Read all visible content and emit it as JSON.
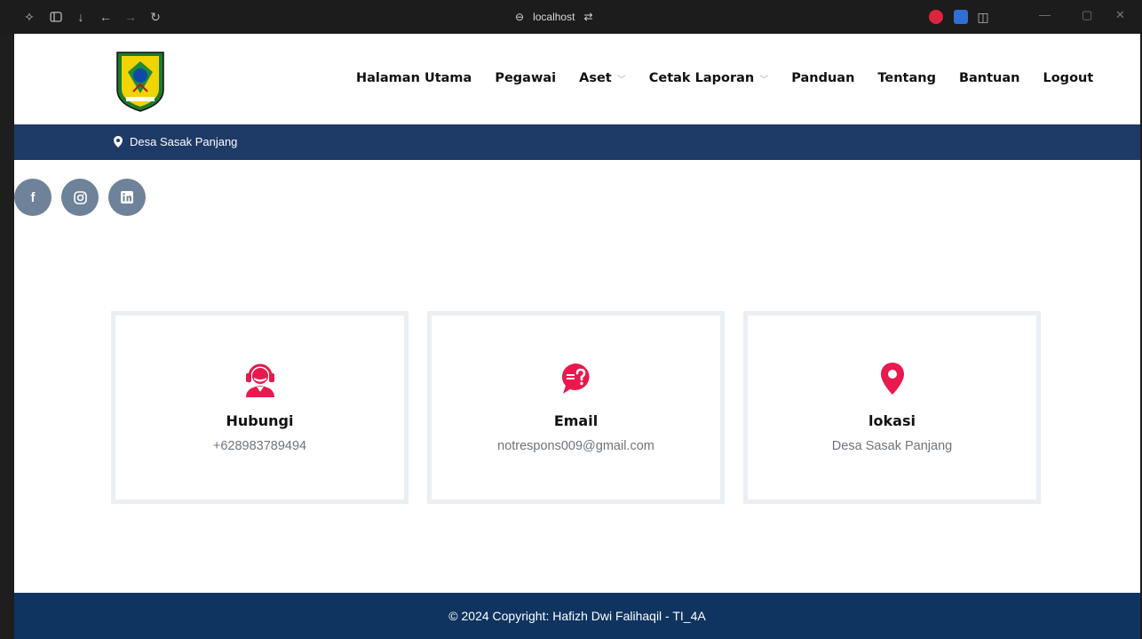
{
  "browser": {
    "url": "localhost"
  },
  "nav": {
    "items": [
      {
        "label": "Halaman Utama",
        "dropdown": false
      },
      {
        "label": "Pegawai",
        "dropdown": false
      },
      {
        "label": "Aset",
        "dropdown": true
      },
      {
        "label": "Cetak Laporan",
        "dropdown": true
      },
      {
        "label": "Panduan",
        "dropdown": false
      },
      {
        "label": "Tentang",
        "dropdown": false
      },
      {
        "label": "Bantuan",
        "dropdown": false
      },
      {
        "label": "Logout",
        "dropdown": false
      }
    ]
  },
  "topbar": {
    "location": "Desa Sasak Panjang"
  },
  "social": [
    "facebook-icon",
    "instagram-icon",
    "linkedin-icon"
  ],
  "cards": [
    {
      "icon": "customer-service-icon",
      "title": "Hubungi",
      "value": "+628983789494"
    },
    {
      "icon": "chat-question-icon",
      "title": "Email",
      "value": "notrespons009@gmail.com"
    },
    {
      "icon": "location-pin-icon",
      "title": "lokasi",
      "value": "Desa Sasak Panjang"
    }
  ],
  "footer": {
    "copyright": "© 2024 Copyright: Hafizh Dwi Falihaqil - TI_4A"
  },
  "colors": {
    "accent": "#e8194d",
    "topbar": "#1e3a66",
    "footer": "#0f3460",
    "social": "#6e8299"
  }
}
